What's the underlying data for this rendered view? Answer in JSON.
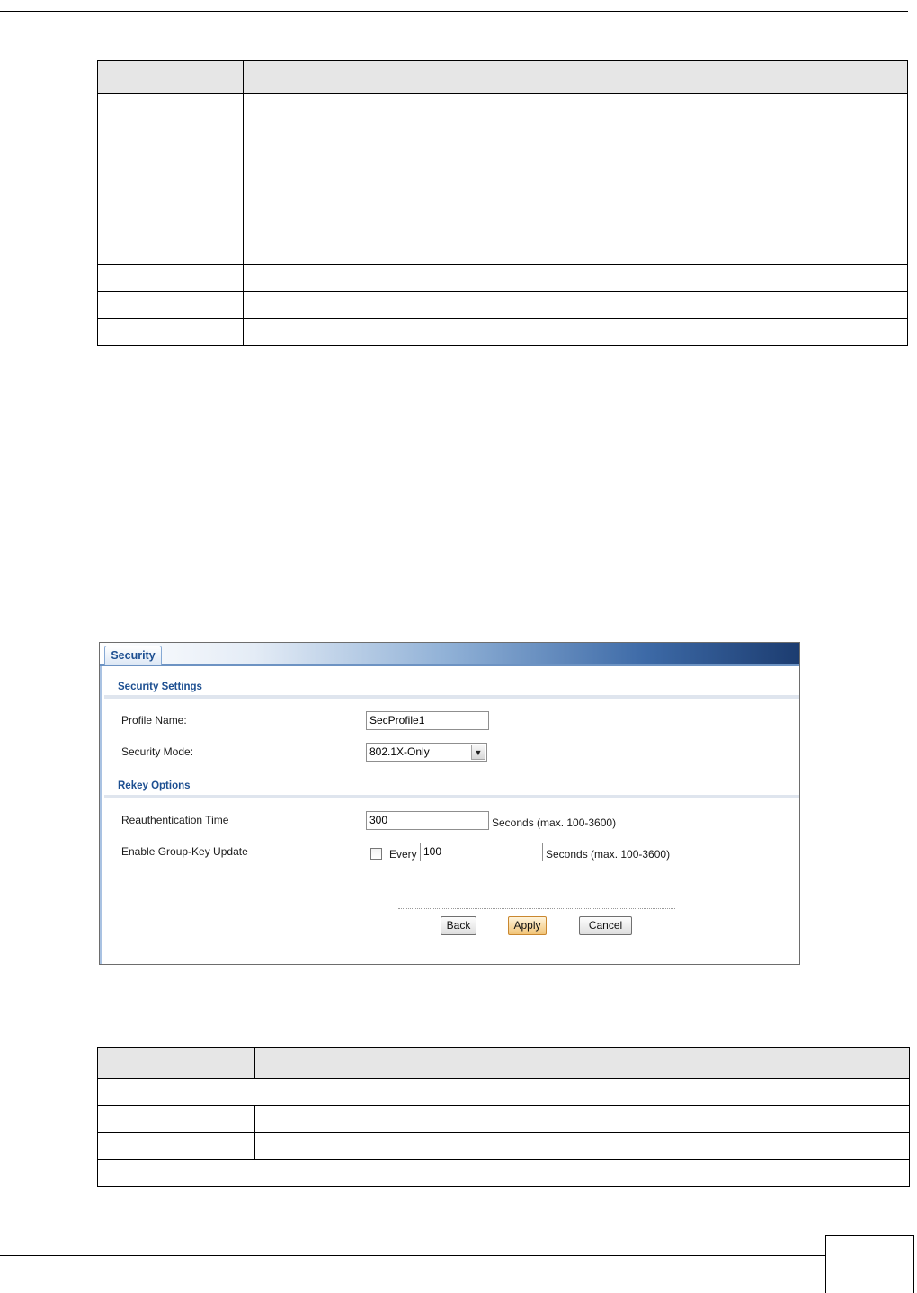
{
  "panel": {
    "tab_label": "Security",
    "security_settings": {
      "title": "Security Settings",
      "profile_name_label": "Profile Name:",
      "profile_name_value": "SecProfile1",
      "security_mode_label": "Security Mode:",
      "security_mode_value": "802.1X-Only"
    },
    "rekey_options": {
      "title": "Rekey Options",
      "reauth_label": "Reauthentication Time",
      "reauth_value": "300",
      "reauth_unit": "Seconds (max. 100-3600)",
      "group_key_label": "Enable Group-Key Update",
      "group_key_checked": false,
      "every_label": "Every",
      "every_value": "100",
      "every_unit": "Seconds (max. 100-3600)"
    },
    "buttons": {
      "back": "Back",
      "apply": "Apply",
      "cancel": "Cancel"
    }
  }
}
